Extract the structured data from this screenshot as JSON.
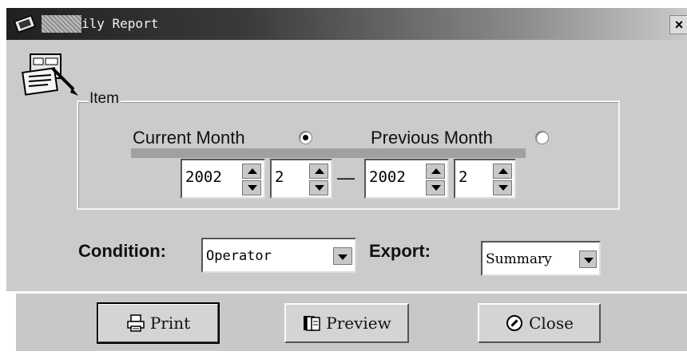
{
  "window": {
    "title": "ily Report",
    "close_label": "×"
  },
  "item_group": {
    "legend": "Item",
    "current_month_label": "Current Month",
    "current_month_selected": true,
    "previous_month_label": "Previous Month",
    "previous_month_selected": false,
    "from_year": "2002",
    "from_month": "2",
    "range_separator": "—",
    "to_year": "2002",
    "to_month": "2"
  },
  "condition": {
    "label": "Condition:",
    "value": "Operator"
  },
  "export": {
    "label": "Export:",
    "value": "Summary"
  },
  "buttons": {
    "print": "Print",
    "preview": "Preview",
    "close": "Close"
  },
  "icons": {
    "window_logo": "chip-icon",
    "report": "report-icon",
    "print": "printer-icon",
    "preview": "pages-icon",
    "close": "power-icon"
  },
  "colors": {
    "window_bg": "#cbcbcb",
    "titlebar_dark": "#202020",
    "titlebar_light": "#c9c9c9"
  }
}
